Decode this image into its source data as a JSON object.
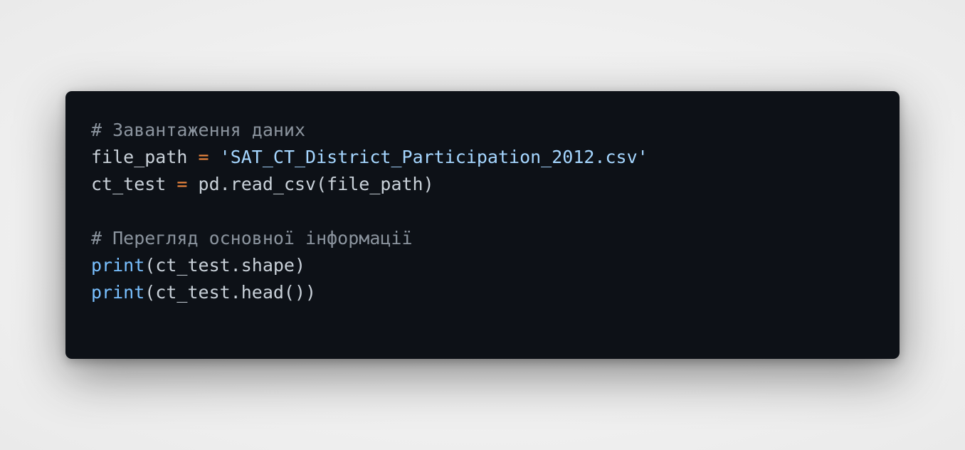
{
  "code": {
    "language": "python",
    "lines": [
      {
        "tokens": [
          {
            "type": "comment",
            "text": "# Завантаження даних"
          }
        ]
      },
      {
        "tokens": [
          {
            "type": "plain",
            "text": "file_path "
          },
          {
            "type": "op",
            "text": "="
          },
          {
            "type": "plain",
            "text": " "
          },
          {
            "type": "string",
            "text": "'SAT_CT_District_Participation_2012.csv'"
          }
        ]
      },
      {
        "tokens": [
          {
            "type": "plain",
            "text": "ct_test "
          },
          {
            "type": "op",
            "text": "="
          },
          {
            "type": "plain",
            "text": " pd.read_csv(file_path)"
          }
        ]
      },
      {
        "tokens": []
      },
      {
        "tokens": [
          {
            "type": "comment",
            "text": "# Перегляд основної інформації"
          }
        ]
      },
      {
        "tokens": [
          {
            "type": "builtin",
            "text": "print"
          },
          {
            "type": "plain",
            "text": "(ct_test.shape)"
          }
        ]
      },
      {
        "tokens": [
          {
            "type": "builtin",
            "text": "print"
          },
          {
            "type": "plain",
            "text": "(ct_test.head())"
          }
        ]
      }
    ]
  },
  "colors": {
    "background": "#0d1117",
    "comment": "#8b949e",
    "operator": "#f0883e",
    "string": "#a5d6ff",
    "builtin": "#79c0ff",
    "text": "#c9d1d9"
  }
}
